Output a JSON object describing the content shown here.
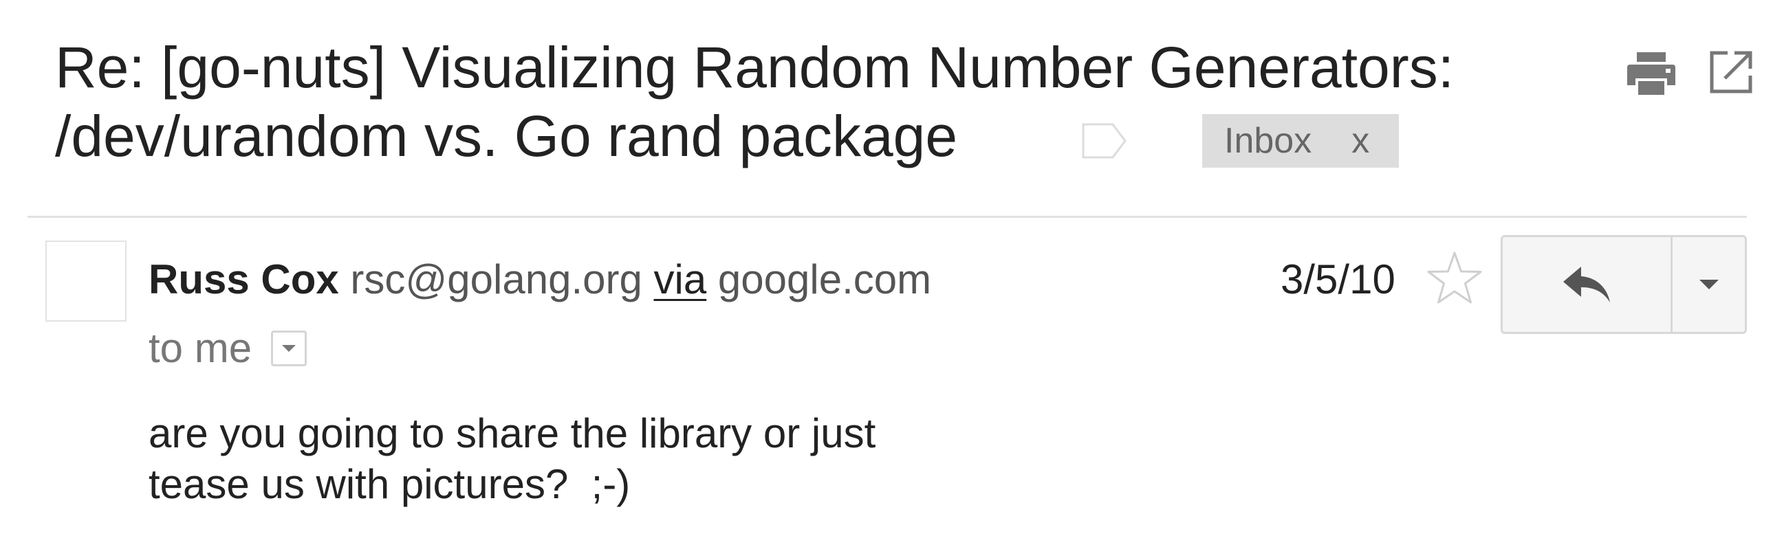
{
  "thread": {
    "subject_lines": [
      "Re: [go-nuts] Visualizing Random Number Generators:",
      "/dev/urandom vs. Go rand package"
    ],
    "label_chip": {
      "label": "Inbox",
      "close": "x"
    }
  },
  "message": {
    "sender_name": "Russ Cox",
    "sender_email": "rsc@golang.org",
    "via_label": "via",
    "via_domain": "google.com",
    "recipient": "to me",
    "date": "3/5/10",
    "body_lines": [
      "are you going to share the library or just",
      "tease us with pictures?  ;-)"
    ]
  },
  "icons": {
    "print": "print-icon",
    "popout": "popout-icon",
    "label": "label-tag-icon",
    "star": "star-icon",
    "reply": "reply-icon",
    "more": "chevron-down-icon",
    "details": "chevron-down-icon"
  },
  "colors": {
    "icon_gray": "#777777",
    "chip_background": "#dddddd",
    "chip_text": "#666666",
    "divider": "#e1e1e1",
    "button_background": "#f5f5f5"
  }
}
